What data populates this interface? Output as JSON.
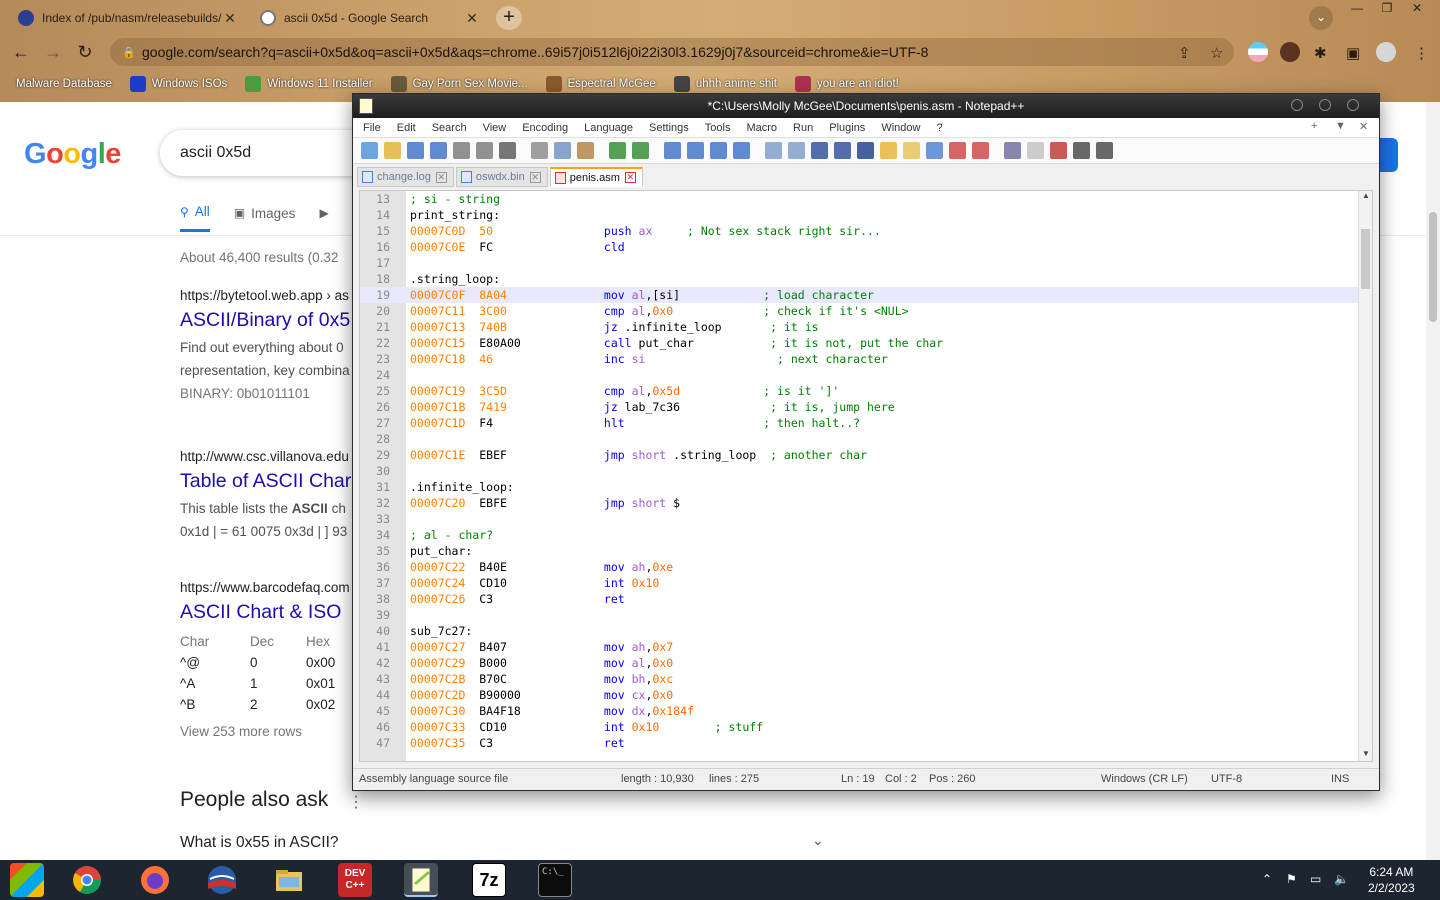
{
  "chrome": {
    "tabs": [
      {
        "title": "Index of /pub/nasm/releasebuilds/",
        "active": false
      },
      {
        "title": "ascii 0x5d - Google Search",
        "active": true
      }
    ],
    "url": "google.com/search?q=ascii+0x5d&oq=ascii+0x5d&aqs=chrome..69i57j0i512l6j0i22i30l3.1629j0j7&sourceid=chrome&ie=UTF-8",
    "bookmarks": [
      {
        "label": "Malware Database",
        "color": "#b8863b"
      },
      {
        "label": "Windows ISOs",
        "color": "#1a3ec9"
      },
      {
        "label": "Windows 11 Installer",
        "color": "#4e9a3c"
      },
      {
        "label": "Gay Porn Sex Movie...",
        "color": "#6b5a3a"
      },
      {
        "label": "Espectral McGee",
        "color": "#8b5a2b"
      },
      {
        "label": "uhhh anime shit",
        "color": "#444444"
      },
      {
        "label": "you are an idiot!",
        "color": "#b03050"
      }
    ]
  },
  "google": {
    "logo": "Google",
    "query": "ascii 0x5d",
    "tabs": [
      "All",
      "Images"
    ],
    "results_count": "About 46,400 results (0.32",
    "results": [
      {
        "url": "https://bytetool.web.app › as",
        "title": "ASCII/Binary of 0x5",
        "snippet": [
          "Find out everything about 0",
          "representation, key combina",
          "BINARY: 0b01011101"
        ]
      },
      {
        "url": "http://www.csc.villanova.edu",
        "title": "Table of ASCII Char",
        "snippet_parts": {
          "before": "This table lists the ",
          "bold": "ASCII",
          "after": " ch"
        },
        "snippet2": "0x1d | = 61 0075 0x3d | ] 93"
      },
      {
        "url": "https://www.barcodefaq.com",
        "title": "ASCII Chart & ISO"
      }
    ],
    "ascii_table": {
      "headers": [
        "Char",
        "Dec",
        "Hex"
      ],
      "rows": [
        [
          "^@",
          "0",
          "0x00"
        ],
        [
          "^A",
          "1",
          "0x01"
        ],
        [
          "^B",
          "2",
          "0x02"
        ]
      ]
    },
    "view_more": "View 253 more rows",
    "paa_title": "People also ask",
    "paa_question": "What is 0x55 in ASCII?"
  },
  "npp": {
    "title": "*C:\\Users\\Molly McGee\\Documents\\penis.asm - Notepad++",
    "menu": [
      "File",
      "Edit",
      "Search",
      "View",
      "Encoding",
      "Language",
      "Settings",
      "Tools",
      "Macro",
      "Run",
      "Plugins",
      "Window",
      "?"
    ],
    "tabs": [
      {
        "label": "change.log",
        "active": false
      },
      {
        "label": "oswdx.bin",
        "active": false
      },
      {
        "label": "penis.asm",
        "active": true
      }
    ],
    "current_line": 19,
    "lines": [
      {
        "n": 13,
        "t": [
          [
            "cm",
            "; si - string"
          ]
        ]
      },
      {
        "n": 14,
        "t": [
          [
            "plain",
            "print_string:"
          ]
        ]
      },
      {
        "n": 15,
        "addr": "00007C0D",
        "hex": "50",
        "t": [
          [
            "kw",
            "push "
          ],
          [
            "reg",
            "ax"
          ],
          [
            "cm",
            "     ; Not sex stack right sir..."
          ]
        ]
      },
      {
        "n": 16,
        "addr": "00007C0E",
        "hex": "FC",
        "t": [
          [
            "kw",
            "cld"
          ]
        ]
      },
      {
        "n": 17,
        "t": []
      },
      {
        "n": 18,
        "t": [
          [
            "plain",
            ".string_loop:"
          ]
        ]
      },
      {
        "n": 19,
        "addr": "00007C0F",
        "hex": "8A04",
        "t": [
          [
            "kw",
            "mov "
          ],
          [
            "reg",
            "al"
          ],
          [
            "plain",
            ",[si]"
          ],
          [
            "cm",
            "            ; load character"
          ]
        ]
      },
      {
        "n": 20,
        "addr": "00007C11",
        "hex": "3C00",
        "t": [
          [
            "kw",
            "cmp "
          ],
          [
            "reg",
            "al"
          ],
          [
            "plain",
            ","
          ],
          [
            "num",
            "0x0"
          ],
          [
            "cm",
            "             ; check if it's <NUL>"
          ]
        ]
      },
      {
        "n": 21,
        "addr": "00007C13",
        "hex": "740B",
        "t": [
          [
            "kw",
            "jz "
          ],
          [
            "plain",
            ".infinite_loop"
          ],
          [
            "cm",
            "       ; it is"
          ]
        ]
      },
      {
        "n": 22,
        "addr": "00007C15",
        "hex": "E80A00",
        "t": [
          [
            "kw",
            "call "
          ],
          [
            "plain",
            "put_char"
          ],
          [
            "cm",
            "           ; it is not, put the char"
          ]
        ]
      },
      {
        "n": 23,
        "addr": "00007C18",
        "hex": "46",
        "t": [
          [
            "kw",
            "inc "
          ],
          [
            "reg",
            "si"
          ],
          [
            "cm",
            "                   ; next character"
          ]
        ]
      },
      {
        "n": 24,
        "t": []
      },
      {
        "n": 25,
        "addr": "00007C19",
        "hex": "3C5D",
        "t": [
          [
            "kw",
            "cmp "
          ],
          [
            "reg",
            "al"
          ],
          [
            "plain",
            ","
          ],
          [
            "num",
            "0x5d"
          ],
          [
            "cm",
            "            ; is it ']'"
          ]
        ]
      },
      {
        "n": 26,
        "addr": "00007C1B",
        "hex": "7419",
        "t": [
          [
            "kw",
            "jz "
          ],
          [
            "plain",
            "lab_7c36"
          ],
          [
            "cm",
            "             ; it is, jump here"
          ]
        ]
      },
      {
        "n": 27,
        "addr": "00007C1D",
        "hex": "F4",
        "t": [
          [
            "kw",
            "hlt"
          ],
          [
            "cm",
            "                    ; then halt..?"
          ]
        ]
      },
      {
        "n": 28,
        "t": []
      },
      {
        "n": 29,
        "addr": "00007C1E",
        "hex": "EBEF",
        "t": [
          [
            "kw",
            "jmp "
          ],
          [
            "reg",
            "short "
          ],
          [
            "plain",
            ".string_loop"
          ],
          [
            "cm",
            "  ; another char"
          ]
        ]
      },
      {
        "n": 30,
        "t": []
      },
      {
        "n": 31,
        "t": [
          [
            "plain",
            ".infinite_loop:"
          ]
        ]
      },
      {
        "n": 32,
        "addr": "00007C20",
        "hex": "EBFE",
        "t": [
          [
            "kw",
            "jmp "
          ],
          [
            "reg",
            "short "
          ],
          [
            "plain",
            "$"
          ]
        ]
      },
      {
        "n": 33,
        "t": []
      },
      {
        "n": 34,
        "t": [
          [
            "cm",
            "; al - char?"
          ]
        ]
      },
      {
        "n": 35,
        "t": [
          [
            "plain",
            "put_char:"
          ]
        ]
      },
      {
        "n": 36,
        "addr": "00007C22",
        "hex": "B40E",
        "t": [
          [
            "kw",
            "mov "
          ],
          [
            "reg",
            "ah"
          ],
          [
            "plain",
            ","
          ],
          [
            "num",
            "0xe"
          ]
        ]
      },
      {
        "n": 37,
        "addr": "00007C24",
        "hex": "CD10",
        "t": [
          [
            "kw",
            "int "
          ],
          [
            "num",
            "0x10"
          ]
        ]
      },
      {
        "n": 38,
        "addr": "00007C26",
        "hex": "C3",
        "t": [
          [
            "kw",
            "ret"
          ]
        ]
      },
      {
        "n": 39,
        "t": []
      },
      {
        "n": 40,
        "t": [
          [
            "plain",
            "sub_7c27:"
          ]
        ]
      },
      {
        "n": 41,
        "addr": "00007C27",
        "hex": "B407",
        "t": [
          [
            "kw",
            "mov "
          ],
          [
            "reg",
            "ah"
          ],
          [
            "plain",
            ","
          ],
          [
            "num",
            "0x7"
          ]
        ]
      },
      {
        "n": 42,
        "addr": "00007C29",
        "hex": "B000",
        "t": [
          [
            "kw",
            "mov "
          ],
          [
            "reg",
            "al"
          ],
          [
            "plain",
            ","
          ],
          [
            "num",
            "0x0"
          ]
        ]
      },
      {
        "n": 43,
        "addr": "00007C2B",
        "hex": "B70C",
        "t": [
          [
            "kw",
            "mov "
          ],
          [
            "reg",
            "bh"
          ],
          [
            "plain",
            ","
          ],
          [
            "num",
            "0xc"
          ]
        ]
      },
      {
        "n": 44,
        "addr": "00007C2D",
        "hex": "B90000",
        "t": [
          [
            "kw",
            "mov "
          ],
          [
            "reg",
            "cx"
          ],
          [
            "plain",
            ","
          ],
          [
            "num",
            "0x0"
          ]
        ]
      },
      {
        "n": 45,
        "addr": "00007C30",
        "hex": "BA4F18",
        "t": [
          [
            "kw",
            "mov "
          ],
          [
            "reg",
            "dx"
          ],
          [
            "plain",
            ","
          ],
          [
            "num",
            "0x184f"
          ]
        ]
      },
      {
        "n": 46,
        "addr": "00007C33",
        "hex": "CD10",
        "t": [
          [
            "kw",
            "int "
          ],
          [
            "num",
            "0x10"
          ],
          [
            "cm",
            "        ; stuff"
          ]
        ]
      },
      {
        "n": 47,
        "addr": "00007C35",
        "hex": "C3",
        "t": [
          [
            "kw",
            "ret"
          ]
        ]
      }
    ],
    "status": {
      "filetype": "Assembly language source file",
      "length": "length : 10,930",
      "lines": "lines : 275",
      "ln": "Ln : 19",
      "col": "Col : 2",
      "pos": "Pos : 260",
      "eol": "Windows (CR LF)",
      "encoding": "UTF-8",
      "mode": "INS"
    }
  },
  "taskbar": {
    "time": "6:24 AM",
    "date": "2/2/2023",
    "apps": [
      {
        "name": "windows-apps",
        "color": "#2a8f3c"
      },
      {
        "name": "chrome",
        "color": "#db4437"
      },
      {
        "name": "firefox",
        "color": "#ff7139"
      },
      {
        "name": "obama-logo",
        "color": "#2a5ca8"
      },
      {
        "name": "file-explorer",
        "color": "#e8c45a"
      },
      {
        "name": "dev-cpp",
        "color": "#c62828"
      },
      {
        "name": "notepad-plus-plus",
        "color": "#8bc34a"
      },
      {
        "name": "7zip",
        "color": "#ffffff"
      },
      {
        "name": "cmd",
        "color": "#000000"
      }
    ],
    "labels": {
      "dev": "DEV\nC++",
      "zip": "7z",
      "cmd": "C:\\_"
    }
  }
}
